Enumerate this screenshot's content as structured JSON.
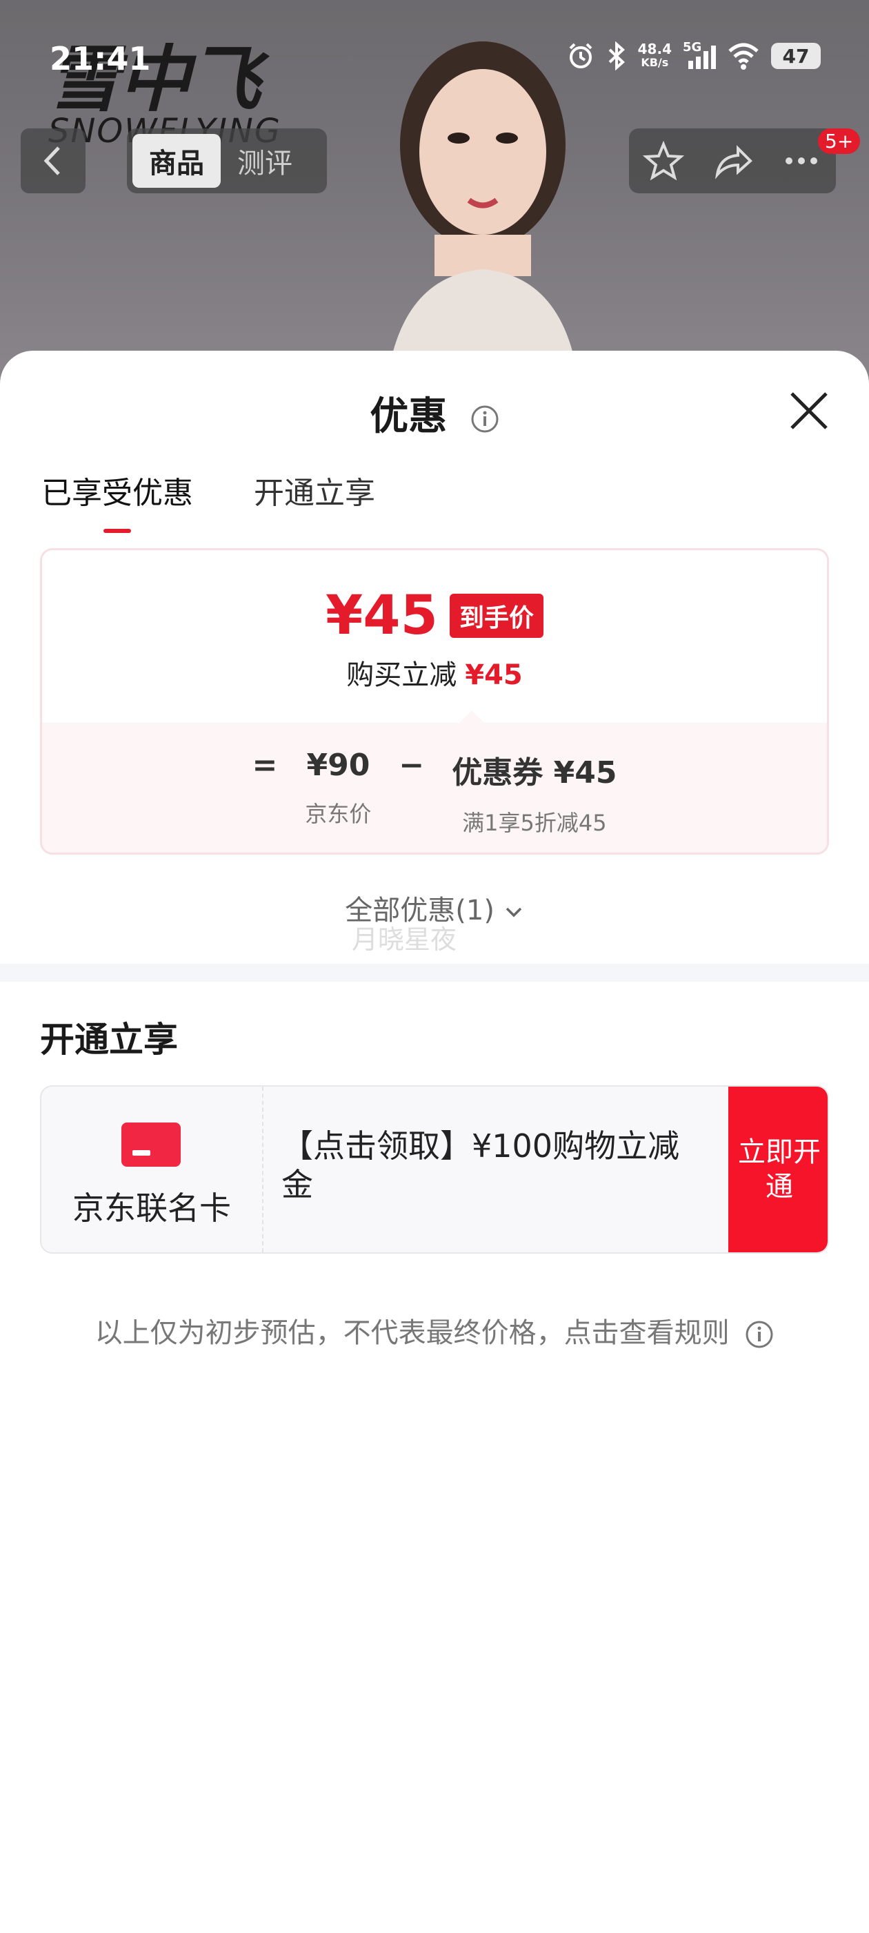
{
  "status_bar": {
    "time": "21:41",
    "net_speed": "48.4",
    "net_unit": "KB/s",
    "network": "5G",
    "battery": "47"
  },
  "background": {
    "brand_cn": "雪中飞",
    "brand_en": "SNOWFLYING"
  },
  "nav": {
    "tabs": [
      "商品",
      "测评"
    ],
    "badge": "5+"
  },
  "sheet": {
    "title": "优惠",
    "tabs": [
      "已享受优惠",
      "开通立享"
    ],
    "price_card": {
      "final_price": "¥45",
      "final_tag": "到手价",
      "reduce_label": "购买立减",
      "reduce_value": "¥45",
      "equals": "=",
      "minus": "−",
      "jd_price": "¥90",
      "jd_price_label": "京东价",
      "coupon": "优惠券 ¥45",
      "coupon_label": "满1享5折减45"
    },
    "all_promos": "全部优惠(1)",
    "watermark": "月晓星夜",
    "section_title": "开通立享",
    "offer": {
      "card_name": "京东联名卡",
      "text": "【点击领取】¥100购物立减金",
      "button": "立即开通"
    },
    "disclaimer": "以上仅为初步预估，不代表最终价格，点击查看规则"
  },
  "colors": {
    "accent": "#e41b2b",
    "button": "#f5142a"
  }
}
